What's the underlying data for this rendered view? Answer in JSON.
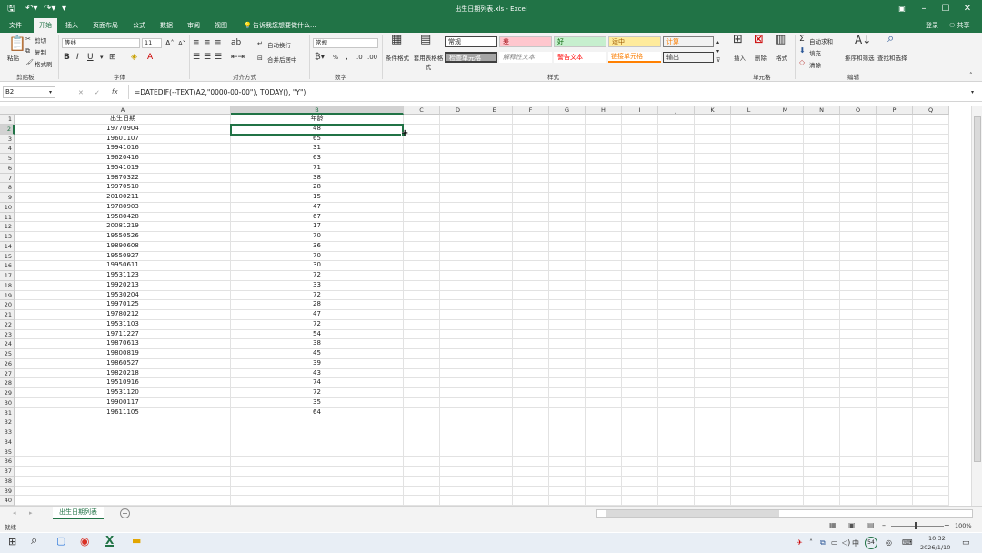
{
  "title_bar": {
    "title": "出生日期列表.xls - Excel",
    "save_icon": "save-icon",
    "undo_icon": "undo-icon",
    "redo_icon": "redo-icon"
  },
  "account": {
    "login": "登录",
    "share": "共享"
  },
  "tabs": [
    "文件",
    "开始",
    "插入",
    "页面布局",
    "公式",
    "数据",
    "审阅",
    "视图"
  ],
  "tell_me": "告诉我您想要做什么...",
  "ribbon": {
    "clipboard": {
      "paste": "粘贴",
      "cut": "剪切",
      "copy": "复制",
      "format_painter": "格式刷",
      "label": "剪贴板"
    },
    "font": {
      "name": "等线",
      "size": "11",
      "label": "字体"
    },
    "alignment": {
      "wrap": "自动换行",
      "merge": "合并后居中",
      "label": "对齐方式"
    },
    "number": {
      "format": "常规",
      "percent": "%",
      "label": "数字"
    },
    "styles": {
      "conditional": "条件格式",
      "table": "套用表格格式",
      "cells": [
        "常规",
        "差",
        "好",
        "适中",
        "计算",
        "检查单元格",
        "解释性文本",
        "警告文本",
        "链接单元格",
        "输出"
      ],
      "label": "样式"
    },
    "cells": {
      "insert": "插入",
      "delete": "删除",
      "format": "格式",
      "label": "单元格"
    },
    "editing": {
      "autosum": "自动求和",
      "fill": "填充",
      "clear": "清除",
      "sort": "排序和筛选",
      "find": "查找和选择",
      "label": "编辑"
    }
  },
  "formula_bar": {
    "name_box": "B2",
    "fx": "fx",
    "formula": "=DATEDIF(--TEXT(A2,\"0000-00-00\"), TODAY(), \"Y\")"
  },
  "columns": [
    "A",
    "B",
    "C",
    "D",
    "E",
    "F",
    "G",
    "H",
    "I",
    "J",
    "K",
    "L",
    "M",
    "N",
    "O",
    "P",
    "Q"
  ],
  "sheet": {
    "header": {
      "a": "出生日期",
      "b": "年龄"
    },
    "rows": [
      [
        "19770904",
        "48"
      ],
      [
        "19601107",
        "65"
      ],
      [
        "19941016",
        "31"
      ],
      [
        "19620416",
        "63"
      ],
      [
        "19541019",
        "71"
      ],
      [
        "19870322",
        "38"
      ],
      [
        "19970510",
        "28"
      ],
      [
        "20100211",
        "15"
      ],
      [
        "19780903",
        "47"
      ],
      [
        "19580428",
        "67"
      ],
      [
        "20081219",
        "17"
      ],
      [
        "19550526",
        "70"
      ],
      [
        "19890608",
        "36"
      ],
      [
        "19550927",
        "70"
      ],
      [
        "19950611",
        "30"
      ],
      [
        "19531123",
        "72"
      ],
      [
        "19920213",
        "33"
      ],
      [
        "19530204",
        "72"
      ],
      [
        "19970125",
        "28"
      ],
      [
        "19780212",
        "47"
      ],
      [
        "19531103",
        "72"
      ],
      [
        "19711227",
        "54"
      ],
      [
        "19870613",
        "38"
      ],
      [
        "19800819",
        "45"
      ],
      [
        "19860527",
        "39"
      ],
      [
        "19820218",
        "43"
      ],
      [
        "19510916",
        "74"
      ],
      [
        "19531120",
        "72"
      ],
      [
        "19900117",
        "35"
      ],
      [
        "19611105",
        "64"
      ]
    ],
    "row_count": 40
  },
  "sheet_tabs": {
    "active": "出生日期列表",
    "add": "+"
  },
  "status": {
    "ready": "就绪",
    "zoom": "100%"
  },
  "taskbar": {
    "time": "10:32",
    "date": "2026/1/10",
    "ime": "中",
    "badge": "54"
  }
}
